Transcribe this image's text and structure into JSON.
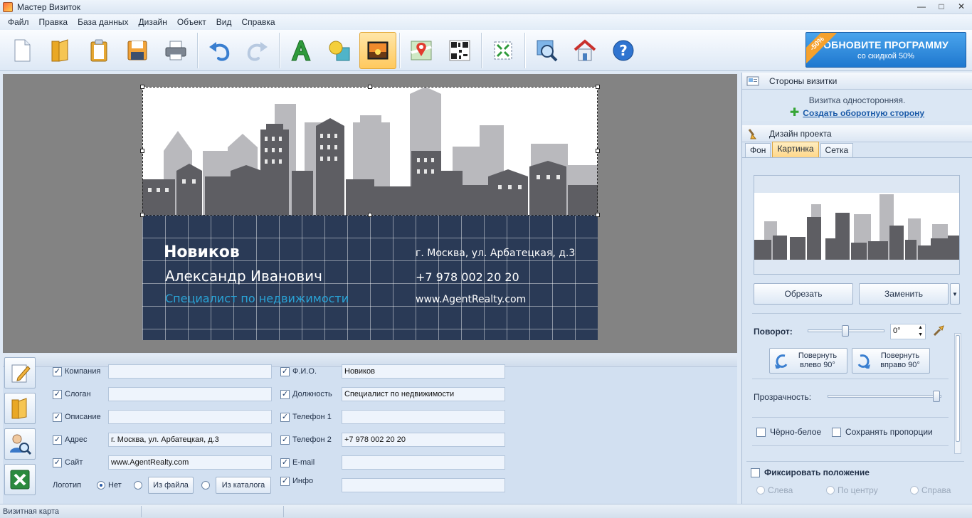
{
  "window": {
    "title": "Мастер Визиток"
  },
  "menu": [
    "Файл",
    "Правка",
    "База данных",
    "Дизайн",
    "Объект",
    "Вид",
    "Справка"
  ],
  "promo": {
    "title": "ОБНОВИТЕ ПРОГРАММУ",
    "subtitle": "со скидкой 50%",
    "badge": "-50%"
  },
  "card": {
    "surname": "Новиков",
    "name": "Александр Иванович",
    "position": "Специалист по недвижимости",
    "address": "г. Москва, ул. Арбатецкая, д.3",
    "phone": "+7 978 002 20 20",
    "site": "www.AgentRealty.com",
    "colors": {
      "bottom": "#2a3a56",
      "position": "#29a3d6",
      "skyline_back": "#b9b9bd",
      "skyline_front": "#5e5e63"
    }
  },
  "form": {
    "left": [
      {
        "label": "Компания",
        "value": ""
      },
      {
        "label": "Слоган",
        "value": ""
      },
      {
        "label": "Описание",
        "value": ""
      },
      {
        "label": "Адрес",
        "value": "г. Москва, ул. Арбатецкая, д.3"
      },
      {
        "label": "Сайт",
        "value": "www.AgentRealty.com"
      }
    ],
    "right": [
      {
        "label": "Ф.И.О.",
        "value": "Новиков"
      },
      {
        "label": "Должность",
        "value": "Специалист по недвижимости"
      },
      {
        "label": "Телефон 1",
        "value": ""
      },
      {
        "label": "Телефон 2",
        "value": "+7 978 002 20 20"
      },
      {
        "label": "E-mail",
        "value": ""
      },
      {
        "label": "Инфо",
        "value": ""
      }
    ],
    "logo": {
      "label": "Логотип",
      "none": "Нет",
      "from_file": "Из файла",
      "from_catalog": "Из каталога"
    }
  },
  "panel": {
    "sides_title": "Стороны визитки",
    "sides_text": "Визитка односторонняя.",
    "sides_link": "Создать оборотную сторону",
    "design_title": "Дизайн проекта",
    "tabs": [
      "Фон",
      "Картинка",
      "Сетка"
    ],
    "crop": "Обрезать",
    "replace": "Заменить",
    "rotation_label": "Поворот:",
    "rotation_value": "0°",
    "rotate_left_1": "Повернуть",
    "rotate_left_2": "влево 90°",
    "rotate_right_1": "Повернуть",
    "rotate_right_2": "вправо 90°",
    "transparency_label": "Прозрачность:",
    "bw": "Чёрно-белое",
    "keep_ratio": "Сохранять пропорции",
    "fix_position": "Фиксировать положение",
    "left": "Слева",
    "center": "По центру",
    "right": "Справа"
  },
  "status": {
    "text": "Визитная карта"
  }
}
